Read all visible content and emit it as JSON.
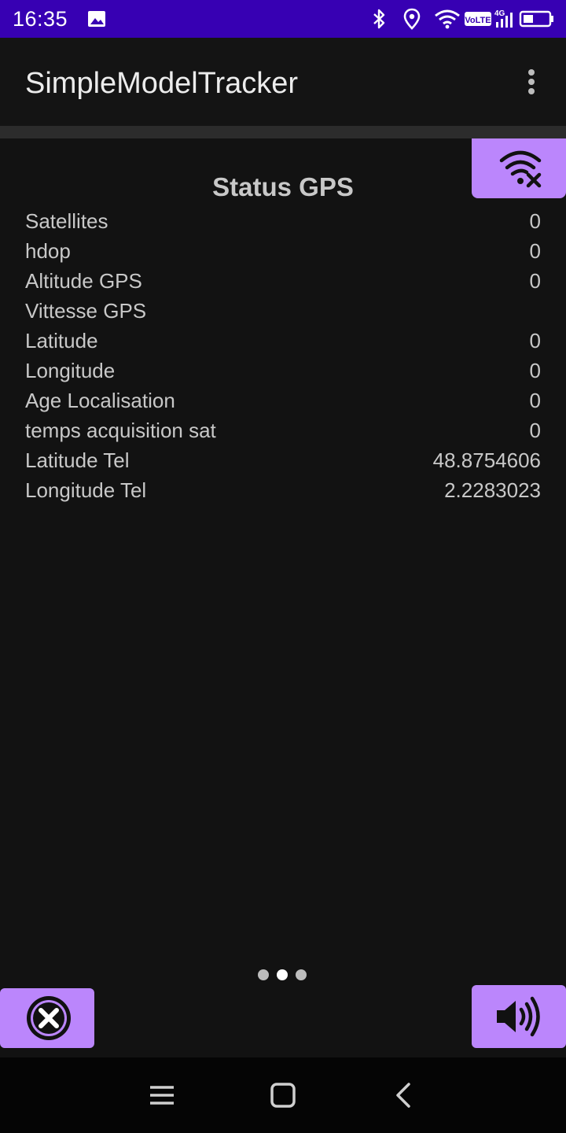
{
  "status_bar": {
    "time": "16:35",
    "volte_badge": "VoLTE",
    "network_type": "4G",
    "icons": [
      "image-icon",
      "bluetooth-icon",
      "location-icon",
      "wifi-icon",
      "volte-icon",
      "signal-icon",
      "battery-icon"
    ]
  },
  "app_bar": {
    "title": "SimpleModelTracker",
    "menu_icon": "more-vert-icon"
  },
  "gps_status": {
    "title": "Status GPS",
    "rows": [
      {
        "label": "Satellites",
        "value": "0"
      },
      {
        "label": "hdop",
        "value": "0"
      },
      {
        "label": "Altitude GPS",
        "value": "0"
      },
      {
        "label": "Vittesse GPS",
        "value": ""
      },
      {
        "label": "Latitude",
        "value": "0"
      },
      {
        "label": "Longitude",
        "value": "0"
      },
      {
        "label": "Age Localisation",
        "value": "0"
      },
      {
        "label": "temps acquisition sat",
        "value": "0"
      },
      {
        "label": "Latitude Tel",
        "value": "48.8754606"
      },
      {
        "label": "Longitude Tel",
        "value": "2.2283023"
      }
    ]
  },
  "buttons": {
    "wifi_off_icon": "wifi-off-icon",
    "close_icon": "close-circle-icon",
    "sound_icon": "volume-up-icon"
  },
  "pager": {
    "page_count": 3,
    "active_index": 1
  },
  "nav_bar": {
    "icons": [
      "recent-apps-icon",
      "home-icon",
      "back-icon"
    ]
  },
  "colors": {
    "status_bar": "#3700b3",
    "accent": "#bb86fc",
    "background": "#121212",
    "text": "#c8c8c8"
  }
}
